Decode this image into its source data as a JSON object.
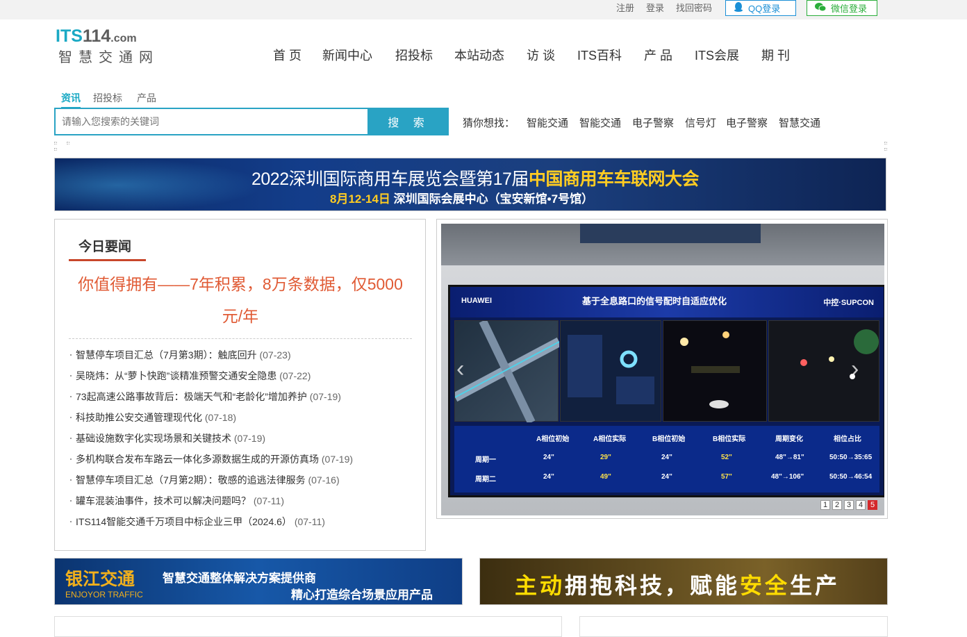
{
  "topbar": {
    "links": [
      "注册",
      "登录",
      "找回密码"
    ],
    "qq_login": "QQ登录",
    "wechat_login": "微信登录"
  },
  "logo": {
    "its": "ITS",
    "num": "114",
    "com": ".com",
    "name": "智慧交通网"
  },
  "nav": [
    "首 页",
    "新闻中心",
    "招投标",
    "本站动态",
    "访 谈",
    "ITS百科",
    "产 品",
    "ITS会展",
    "期 刊"
  ],
  "search": {
    "tabs": [
      "资讯",
      "招投标",
      "产品"
    ],
    "active_tab": "资讯",
    "placeholder": "请输入您搜索的关键词",
    "button": "搜 索",
    "guess_label": "猜你想找：",
    "guess_items": [
      "智能交通",
      "智能交通",
      "电子警察",
      "信号灯",
      "电子警察",
      "智慧交通"
    ]
  },
  "banner_top": {
    "line1_plain": "2022深圳国际商用车展览会暨第17届",
    "line1_highlight": "中国商用车车联网大会",
    "line2_date": "8月12-14日",
    "line2_rest": "深圳国际会展中心（宝安新馆•7号馆）"
  },
  "news": {
    "title": "今日要闻",
    "featured": "你值得拥有——7年积累，8万条数据，仅5000元/年",
    "items": [
      {
        "title": "智慧停车项目汇总（7月第3期）：触底回升",
        "date": "(07-23)"
      },
      {
        "title": "吴晓炜：从“萝卜快跑”谈精准预警交通安全隐患",
        "date": "(07-22)"
      },
      {
        "title": "73起高速公路事故背后：极端天气和“老龄化”增加养护",
        "date": "(07-19)"
      },
      {
        "title": "科技助推公安交通管理现代化",
        "date": "(07-18)"
      },
      {
        "title": "基础设施数字化实现场景和关键技术",
        "date": "(07-19)"
      },
      {
        "title": "多机构联合发布车路云一体化多源数据生成的开源仿真场",
        "date": "(07-19)"
      },
      {
        "title": "智慧停车项目汇总（7月第2期）：敬感的追逃法律服务",
        "date": "(07-16)"
      },
      {
        "title": "罐车混装油事件，技术可以解决问题吗？",
        "date": "(07-11)"
      },
      {
        "title": "ITS114智能交通千万项目中标企业三甲（2024.6）",
        "date": "(07-11)"
      }
    ]
  },
  "slideshow": {
    "screen_brand_left": "HUAWEI",
    "screen_title": "基于全息路口的信号配时自适应优化",
    "screen_brand_right": "中控·SUPCON",
    "table_headers": [
      "A相位初始",
      "A相位实际",
      "B相位初始",
      "B相位实际",
      "周期变化",
      "相位占比"
    ],
    "table_rows": [
      {
        "label": "周期一",
        "values": [
          "24\"",
          "29\"",
          "24\"",
          "52\"",
          "48\"→81\"",
          "50:50→35:65"
        ]
      },
      {
        "label": "周期二",
        "values": [
          "24\"",
          "49\"",
          "24\"",
          "57\"",
          "48\"→106\"",
          "50:50→46:54"
        ]
      }
    ],
    "pages": [
      "1",
      "2",
      "3",
      "4",
      "5"
    ],
    "active_page": 5,
    "prev_arrow": "‹",
    "next_arrow": "›"
  },
  "ad_left": {
    "brand": "银江交通",
    "brand_en": "ENJOYOR TRAFFIC",
    "line1": "智慧交通整体解决方案提供商",
    "line2": "精心打造综合场景应用产品"
  },
  "ad_right": {
    "part1": "主动",
    "part2": "拥抱科技，赋能",
    "part3": "安全",
    "part4": "生产"
  },
  "colors": {
    "accent": "#29a3c4",
    "headline_red": "#e05a34",
    "rule_red": "#c8462a",
    "banner_gold": "#ffcc22"
  }
}
